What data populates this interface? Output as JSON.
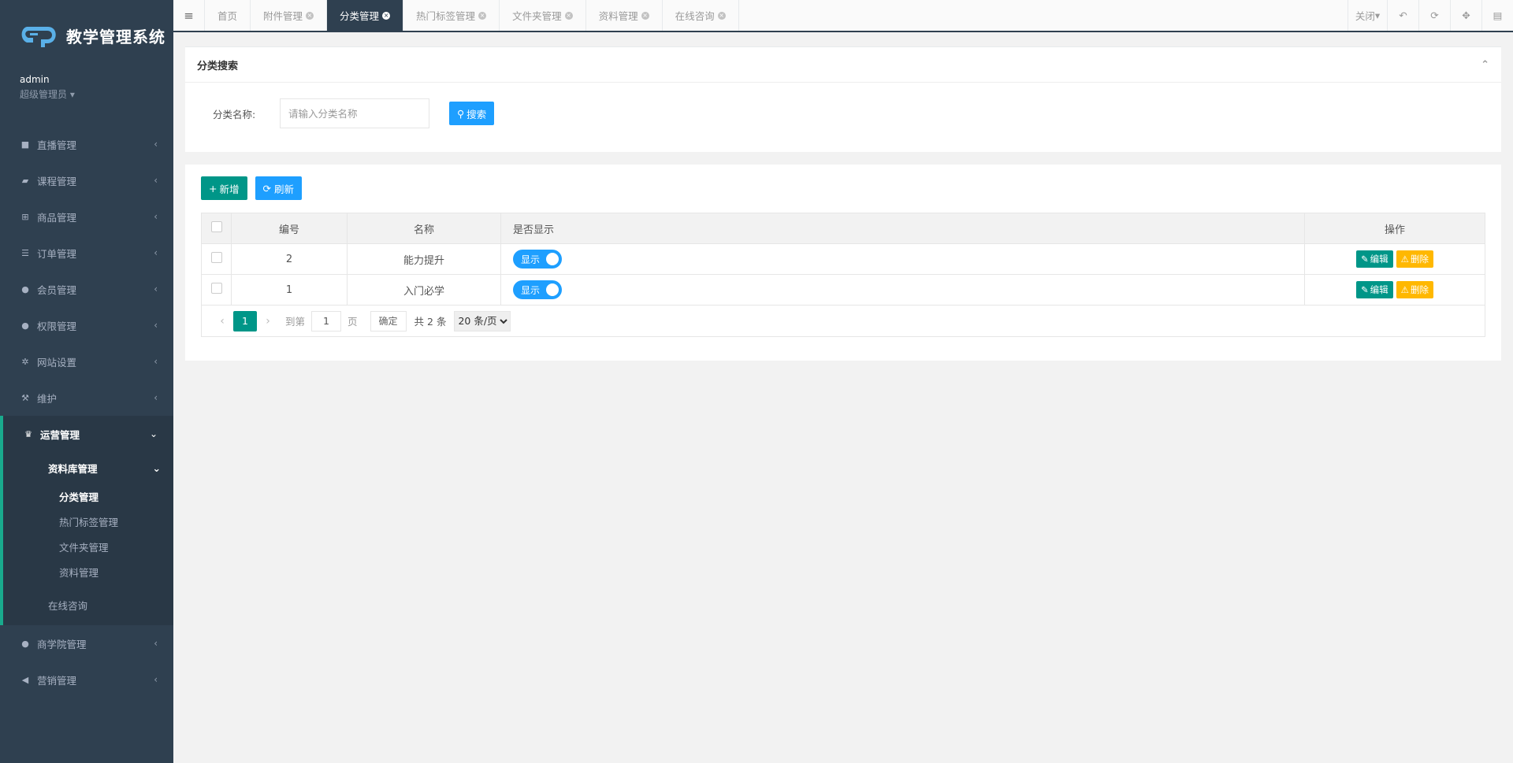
{
  "app": {
    "title": "教学管理系统"
  },
  "user": {
    "name": "admin",
    "role": "超级管理员"
  },
  "sidebar": {
    "items": [
      {
        "label": "直播管理",
        "icon": "video-camera-icon"
      },
      {
        "label": "课程管理",
        "icon": "book-icon"
      },
      {
        "label": "商品管理",
        "icon": "cart-icon"
      },
      {
        "label": "订单管理",
        "icon": "list-icon"
      },
      {
        "label": "会员管理",
        "icon": "user-icon"
      },
      {
        "label": "权限管理",
        "icon": "users-icon"
      },
      {
        "label": "网站设置",
        "icon": "gear-icon"
      },
      {
        "label": "维护",
        "icon": "wrench-icon"
      }
    ],
    "active_group": {
      "label": "运营管理",
      "icon": "trophy-icon",
      "submenu": {
        "label": "资料库管理",
        "items": [
          "分类管理",
          "热门标签管理",
          "文件夹管理",
          "资料管理"
        ],
        "active": "分类管理"
      },
      "online": "在线咨询"
    },
    "bottom_items": [
      {
        "label": "商学院管理",
        "icon": "users-icon"
      },
      {
        "label": "营销管理",
        "icon": "bullhorn-icon"
      }
    ]
  },
  "tabs": [
    {
      "label": "首页",
      "closable": false,
      "active": false
    },
    {
      "label": "附件管理",
      "closable": true,
      "active": false
    },
    {
      "label": "分类管理",
      "closable": true,
      "active": true
    },
    {
      "label": "热门标签管理",
      "closable": true,
      "active": false
    },
    {
      "label": "文件夹管理",
      "closable": true,
      "active": false
    },
    {
      "label": "资料管理",
      "closable": true,
      "active": false
    },
    {
      "label": "在线咨询",
      "closable": true,
      "active": false
    }
  ],
  "topbar": {
    "close_label": "关闭"
  },
  "search": {
    "title": "分类搜索",
    "field_label": "分类名称:",
    "placeholder": "请输入分类名称",
    "button": "搜索"
  },
  "toolbar": {
    "add": "新增",
    "refresh": "刷新"
  },
  "table": {
    "columns": [
      "编号",
      "名称",
      "是否显示",
      "操作"
    ],
    "rows": [
      {
        "id": "2",
        "name": "能力提升",
        "show": "显示"
      },
      {
        "id": "1",
        "name": "入门必学",
        "show": "显示"
      }
    ],
    "edit_label": "编辑",
    "delete_label": "删除"
  },
  "pager": {
    "current": "1",
    "goto_prefix": "到第",
    "goto_value": "1",
    "goto_suffix": "页",
    "confirm": "确定",
    "total": "共 2 条",
    "page_size": "20 条/页"
  }
}
